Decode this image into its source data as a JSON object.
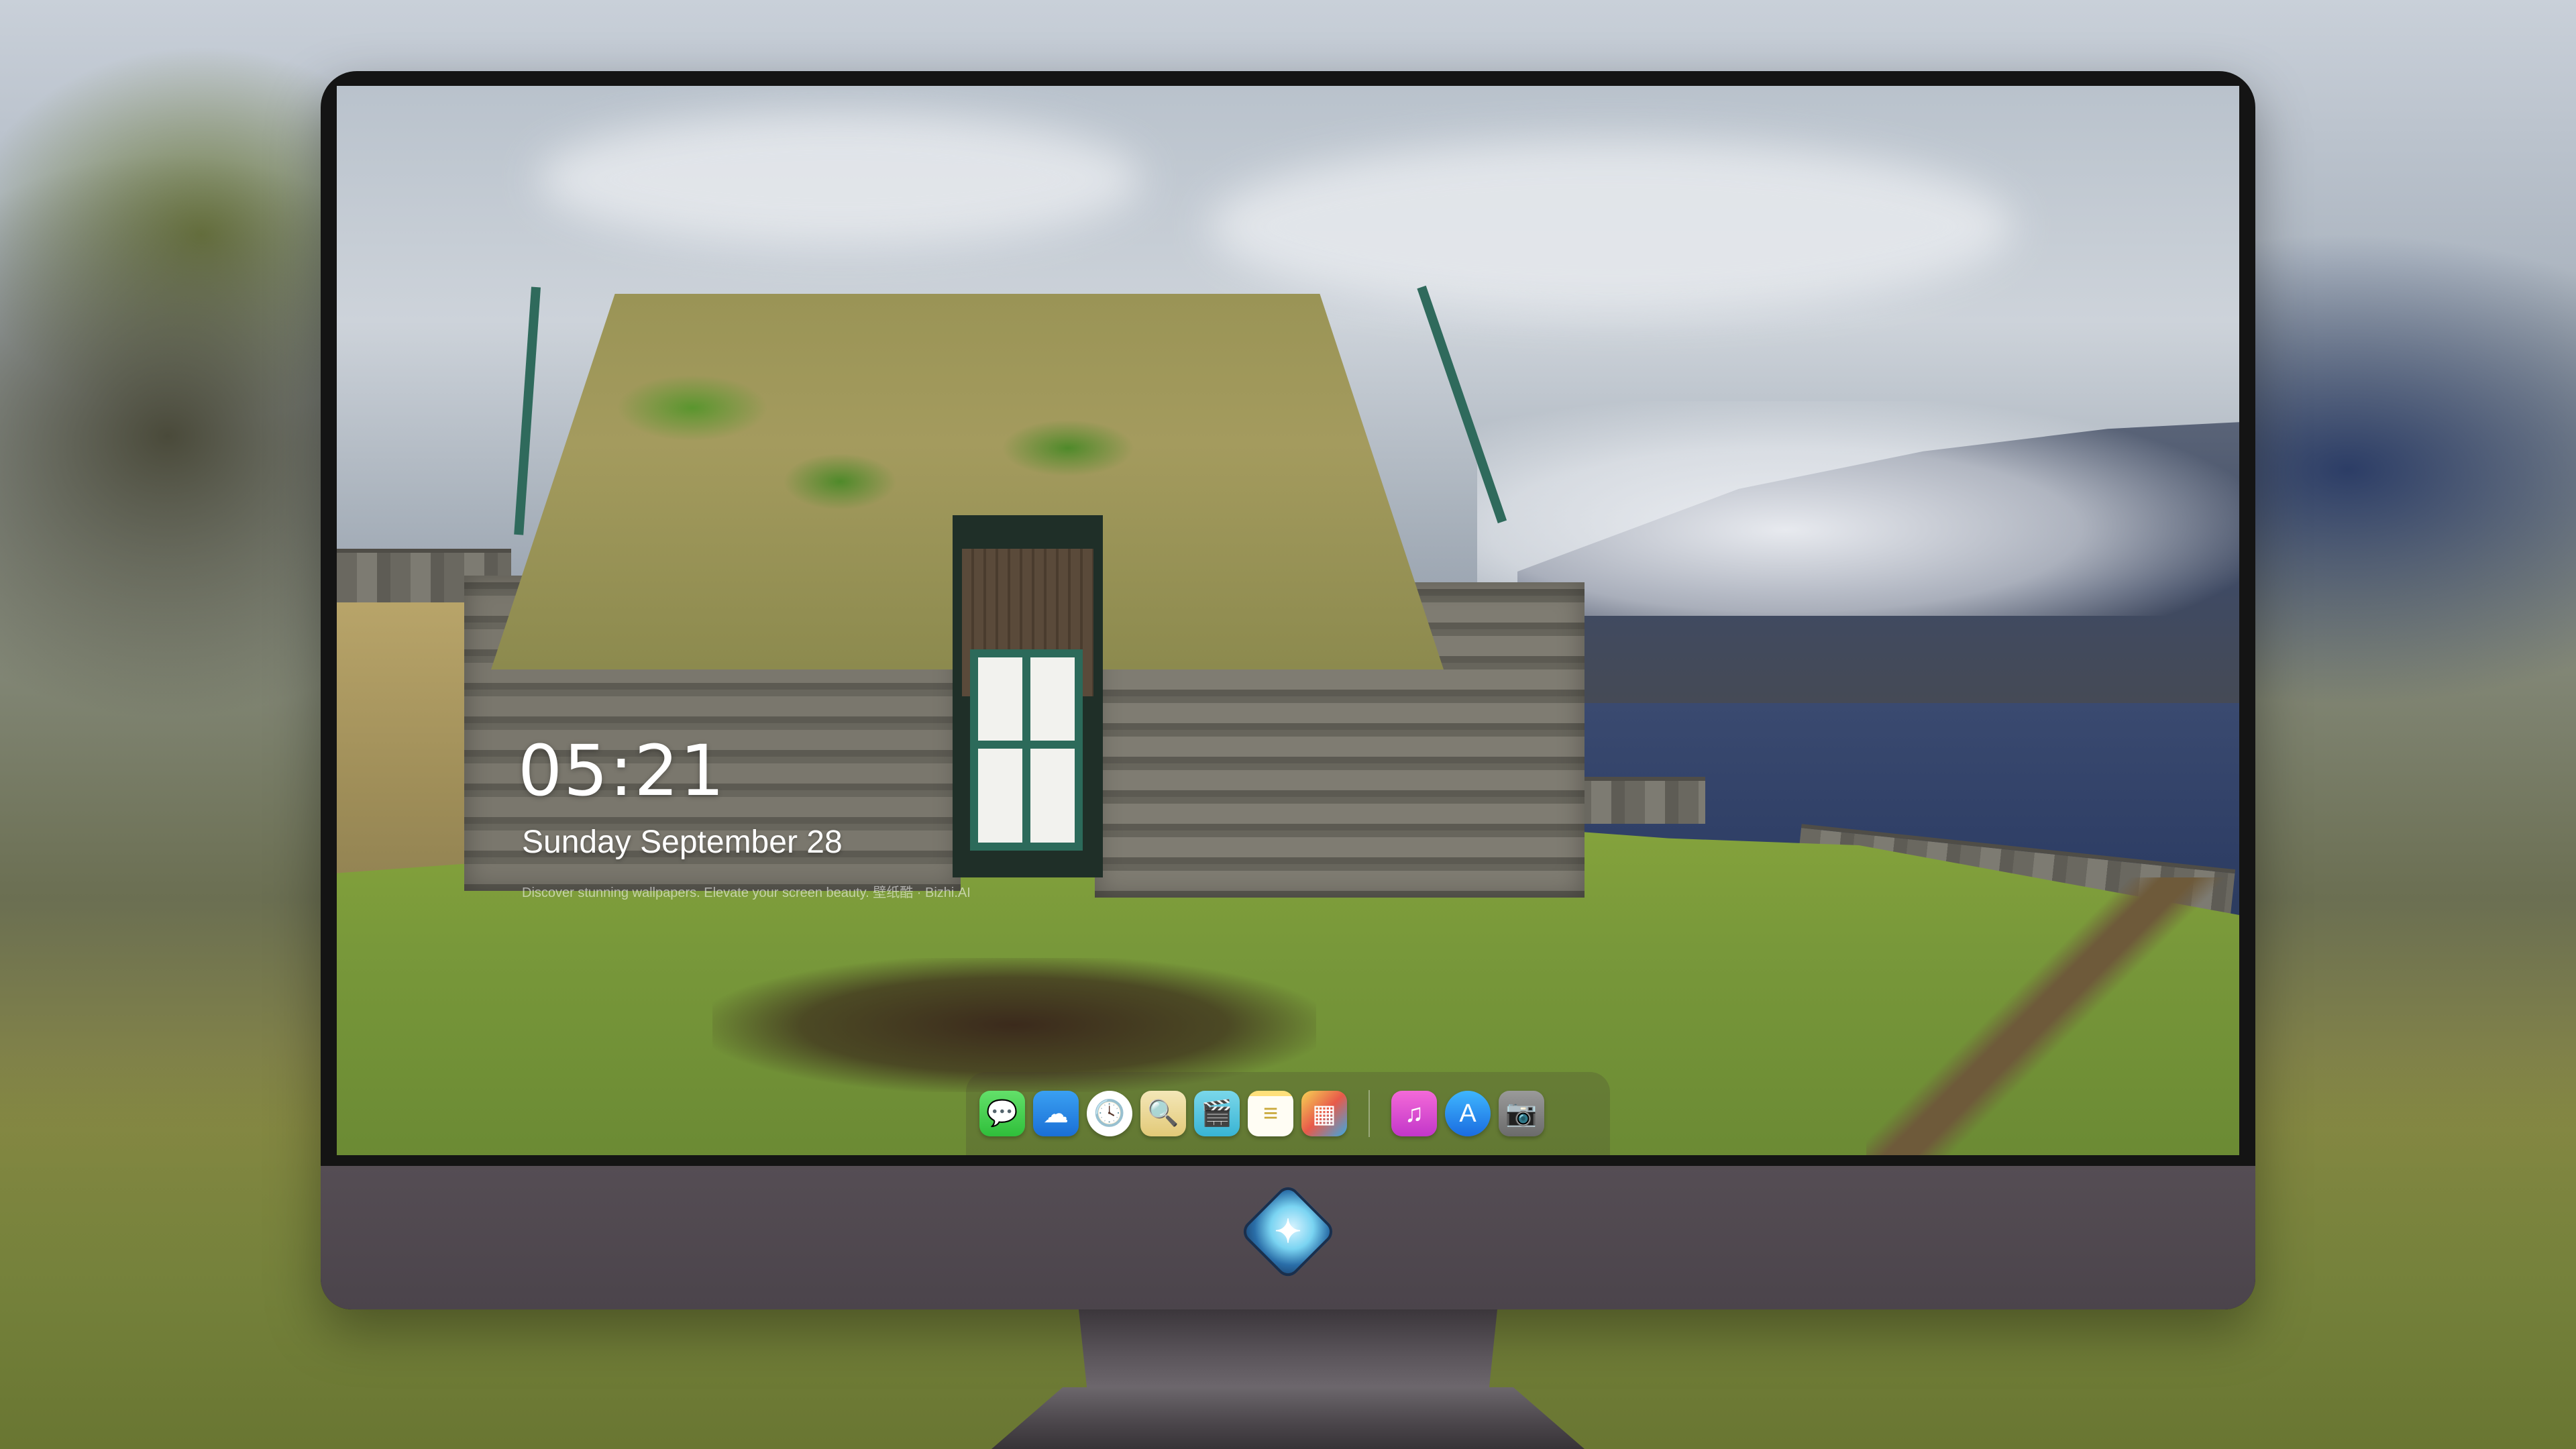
{
  "lock_screen": {
    "time": "05:21",
    "date": "Sunday September  28",
    "tagline": "Discover stunning wallpapers. Elevate your screen beauty. 壁纸酷 · Bizhi.AI"
  },
  "dock": {
    "apps": [
      {
        "name": "Messages",
        "icon": "message-bubble-icon",
        "glyph": "💬"
      },
      {
        "name": "Weather",
        "icon": "weather-icon",
        "glyph": "☁"
      },
      {
        "name": "Clock",
        "icon": "clock-icon",
        "glyph": "🕓"
      },
      {
        "name": "Preview",
        "icon": "preview-icon",
        "glyph": "🔍"
      },
      {
        "name": "Clips",
        "icon": "clapperboard-icon",
        "glyph": "🎬"
      },
      {
        "name": "Notes",
        "icon": "notes-icon",
        "glyph": "≡"
      },
      {
        "name": "Photo Booth",
        "icon": "gallery-icon",
        "glyph": "▦"
      },
      {
        "name": "Music",
        "icon": "music-note-icon",
        "glyph": "♫"
      },
      {
        "name": "App Store",
        "icon": "app-store-icon",
        "glyph": "A"
      },
      {
        "name": "Camera",
        "icon": "camera-icon",
        "glyph": "📷"
      }
    ]
  },
  "monitor": {
    "logo_icon": "mascot-logo-icon"
  },
  "colors": {
    "monitor_bezel": "#141414",
    "monitor_chin": "#4b444b",
    "text_primary": "#ffffff"
  }
}
